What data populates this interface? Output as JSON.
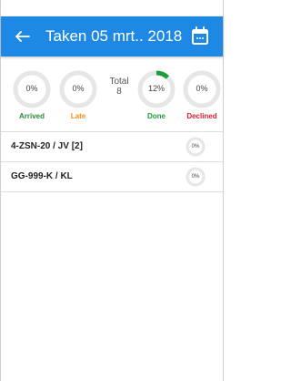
{
  "header": {
    "title": "Taken 05 mrt.. 2018",
    "back_icon": "arrow-left-icon",
    "calendar_icon": "calendar-icon"
  },
  "stats": {
    "arrived": {
      "value": "0%",
      "fraction": 0,
      "label": "Arrived",
      "color": "#2e8b3a"
    },
    "late": {
      "value": "0%",
      "fraction": 0,
      "label": "Late",
      "color": "#f28c1a"
    },
    "total": {
      "label": "Total",
      "value": "8"
    },
    "done": {
      "value": "12%",
      "fraction": 0.12,
      "label": "Done",
      "color": "#1f9d3a"
    },
    "declined": {
      "value": "0%",
      "fraction": 0,
      "label": "Declined",
      "color": "#d91f2d"
    }
  },
  "rows": [
    {
      "label": "4-ZSN-20 / JV [2]",
      "progress_value": "0%",
      "fraction": 0
    },
    {
      "label": "GG-999-K /  KL",
      "progress_value": "0%",
      "fraction": 0
    }
  ],
  "colors": {
    "appbar": "#1e88e5",
    "ring_track": "#e6e6e6",
    "divider": "#dddddd"
  }
}
